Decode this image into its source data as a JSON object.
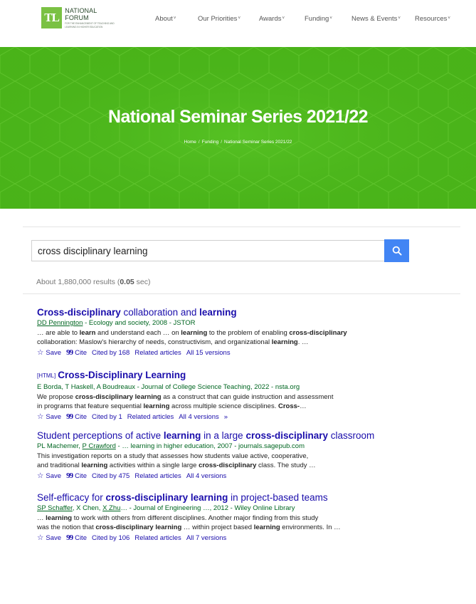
{
  "nav": {
    "logo_mark": "TL",
    "logo_name": "NATIONAL FORUM",
    "logo_sub": "FOR THE ENHANCEMENT OF TEACHING AND LEARNING IN HIGHER EDUCATION",
    "items": [
      {
        "label": "About"
      },
      {
        "label": "Our Priorities"
      },
      {
        "label": "Awards"
      },
      {
        "label": "Funding"
      },
      {
        "label": "News & Events"
      },
      {
        "label": "Resources"
      }
    ]
  },
  "hero": {
    "title": "National Seminar Series 2021/22",
    "breadcrumb": [
      "Home",
      "Funding",
      "National Seminar Series 2021/22"
    ],
    "bg_color": "#4cb71a"
  },
  "search": {
    "query": "cross disciplinary learning",
    "button_color": "#4285f4",
    "results_prefix": "About 1,880,000 results (",
    "results_time": "0.05",
    "results_suffix": " sec)"
  },
  "results": [
    {
      "title_parts": [
        {
          "t": "Cross-disciplinary",
          "b": true
        },
        {
          "t": " collaboration and ",
          "b": false
        },
        {
          "t": "learning",
          "b": true
        }
      ],
      "tag": "",
      "meta_parts": [
        {
          "t": "DD Pennington",
          "u": true
        },
        {
          "t": " - Ecology and society, 2008 - JSTOR",
          "u": false
        }
      ],
      "snippet_lines": [
        [
          {
            "t": "… are able to ",
            "b": false
          },
          {
            "t": "learn",
            "b": true
          },
          {
            "t": " and understand each … on ",
            "b": false
          },
          {
            "t": "learning",
            "b": true
          },
          {
            "t": " to the problem of enabling ",
            "b": false
          },
          {
            "t": "cross-disciplinary",
            "b": true
          }
        ],
        [
          {
            "t": "collaboration: Maslow's hierarchy of needs, constructivism, and organizational ",
            "b": false
          },
          {
            "t": "learning",
            "b": true
          },
          {
            "t": ". …",
            "b": false
          }
        ]
      ],
      "save": "Save",
      "cite": "Cite",
      "cited_by": "Cited by 168",
      "related": "Related articles",
      "versions": "All 15 versions",
      "extra": ""
    },
    {
      "title_parts": [
        {
          "t": "Cross-Disciplinary Learning",
          "b": true
        }
      ],
      "tag": "[HTML]",
      "meta_parts": [
        {
          "t": "E Borda, T Haskell, A Boudreaux - Journal of College Science Teaching, 2022 - nsta.org",
          "u": false
        }
      ],
      "snippet_lines": [
        [
          {
            "t": "We propose ",
            "b": false
          },
          {
            "t": "cross-disciplinary learning",
            "b": true
          },
          {
            "t": " as a construct that can guide instruction and assessment",
            "b": false
          }
        ],
        [
          {
            "t": "in programs that feature sequential ",
            "b": false
          },
          {
            "t": "learning",
            "b": true
          },
          {
            "t": " across multiple science disciplines. ",
            "b": false
          },
          {
            "t": "Cross-",
            "b": true
          },
          {
            "t": "…",
            "b": false
          }
        ]
      ],
      "save": "Save",
      "cite": "Cite",
      "cited_by": "Cited by 1",
      "related": "Related articles",
      "versions": "All 4 versions",
      "extra": "»"
    },
    {
      "title_parts": [
        {
          "t": "Student perceptions of active ",
          "b": false
        },
        {
          "t": "learning",
          "b": true
        },
        {
          "t": " in a large ",
          "b": false
        },
        {
          "t": "cross-disciplinary",
          "b": true
        },
        {
          "t": " classroom",
          "b": false
        }
      ],
      "tag": "",
      "meta_parts": [
        {
          "t": "PL Machemer, ",
          "u": false
        },
        {
          "t": "P Crawford",
          "u": true
        },
        {
          "t": " - … ",
          "u": false
        },
        {
          "t": "learning in higher education, 2007 - journals.sagepub.com",
          "u": false
        }
      ],
      "snippet_lines": [
        [
          {
            "t": "This investigation reports on a study that assesses how students value active, cooperative,",
            "b": false
          }
        ],
        [
          {
            "t": "and traditional ",
            "b": false
          },
          {
            "t": "learning",
            "b": true
          },
          {
            "t": " activities within a single large ",
            "b": false
          },
          {
            "t": "cross-disciplinary",
            "b": true
          },
          {
            "t": " class. The study …",
            "b": false
          }
        ]
      ],
      "save": "Save",
      "cite": "Cite",
      "cited_by": "Cited by 475",
      "related": "Related articles",
      "versions": "All 4 versions",
      "extra": ""
    },
    {
      "title_parts": [
        {
          "t": "Self-efficacy for ",
          "b": false
        },
        {
          "t": "cross-disciplinary learning",
          "b": true
        },
        {
          "t": " in project-based teams",
          "b": false
        }
      ],
      "tag": "",
      "meta_parts": [
        {
          "t": "SP Schaffer",
          "u": true
        },
        {
          "t": ", X Chen, ",
          "u": false
        },
        {
          "t": "X Zhu",
          "u": true
        },
        {
          "t": "… - Journal of Engineering …, 2012 - Wiley Online Library",
          "u": false
        }
      ],
      "snippet_lines": [
        [
          {
            "t": "… ",
            "b": false
          },
          {
            "t": "learning",
            "b": true
          },
          {
            "t": " to work with others from different disciplines. Another major finding from this study",
            "b": false
          }
        ],
        [
          {
            "t": "was the notion that ",
            "b": false
          },
          {
            "t": "cross-disciplinary learning",
            "b": true
          },
          {
            "t": " … within project based ",
            "b": false
          },
          {
            "t": "learning",
            "b": true
          },
          {
            "t": " environments. In …",
            "b": false
          }
        ]
      ],
      "save": "Save",
      "cite": "Cite",
      "cited_by": "Cited by 106",
      "related": "Related articles",
      "versions": "All 7 versions",
      "extra": ""
    }
  ]
}
